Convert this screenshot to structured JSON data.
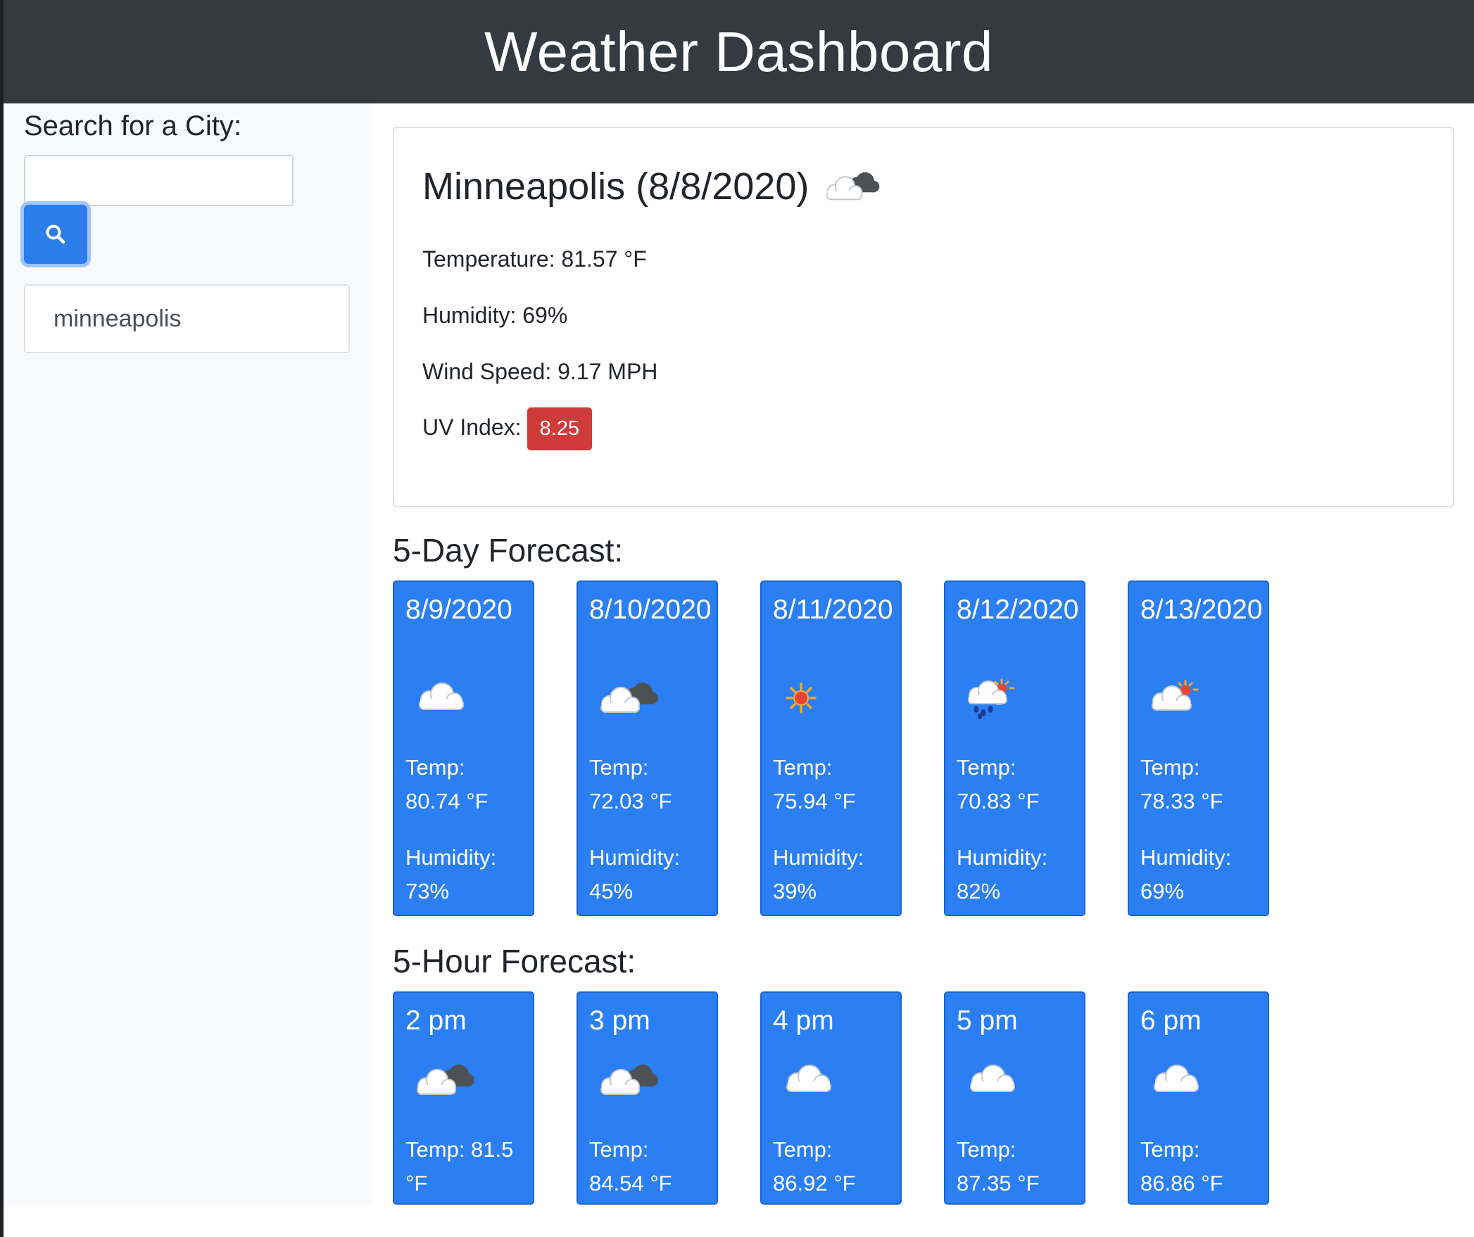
{
  "header": {
    "title": "Weather Dashboard"
  },
  "sidebar": {
    "search_label": "Search for a City:",
    "search_value": "",
    "history": [
      "minneapolis"
    ]
  },
  "current": {
    "city": "Minneapolis (8/8/2020)",
    "icon": "cloud-dark-icon",
    "temperature": "Temperature: 81.57 °F",
    "humidity": "Humidity: 69%",
    "wind": "Wind Speed: 9.17 MPH",
    "uv_label": "UV Index:",
    "uv_value": "8.25",
    "uv_color": "#cf3b3b"
  },
  "daily": {
    "title": "5-Day Forecast:",
    "cards": [
      {
        "date": "8/9/2020",
        "icon": "cloud-icon",
        "temp_label": "Temp:",
        "temp": "80.74 °F",
        "hum_label": "Humidity:",
        "humidity": "73%"
      },
      {
        "date": "8/10/2020",
        "icon": "cloud-dark-icon",
        "temp_label": "Temp:",
        "temp": "72.03 °F",
        "hum_label": "Humidity:",
        "humidity": "45%"
      },
      {
        "date": "8/11/2020",
        "icon": "sun-icon",
        "temp_label": "Temp:",
        "temp": "75.94 °F",
        "hum_label": "Humidity:",
        "humidity": "39%"
      },
      {
        "date": "8/12/2020",
        "icon": "rain-sun-icon",
        "temp_label": "Temp:",
        "temp": "70.83 °F",
        "hum_label": "Humidity:",
        "humidity": "82%"
      },
      {
        "date": "8/13/2020",
        "icon": "cloud-sun-icon",
        "temp_label": "Temp:",
        "temp": "78.33 °F",
        "hum_label": "Humidity:",
        "humidity": "69%"
      }
    ]
  },
  "hourly": {
    "title": "5-Hour Forecast:",
    "cards": [
      {
        "time": "2 pm",
        "icon": "cloud-dark-icon",
        "temp_line1": "Temp: 81.5",
        "temp_line2": "°F"
      },
      {
        "time": "3 pm",
        "icon": "cloud-dark-icon",
        "temp_line1": "Temp:",
        "temp_line2": "84.54 °F"
      },
      {
        "time": "4 pm",
        "icon": "cloud-icon",
        "temp_line1": "Temp:",
        "temp_line2": "86.92 °F"
      },
      {
        "time": "5 pm",
        "icon": "cloud-icon",
        "temp_line1": "Temp:",
        "temp_line2": "87.35 °F"
      },
      {
        "time": "6 pm",
        "icon": "cloud-icon",
        "temp_line1": "Temp:",
        "temp_line2": "86.86 °F"
      }
    ]
  }
}
